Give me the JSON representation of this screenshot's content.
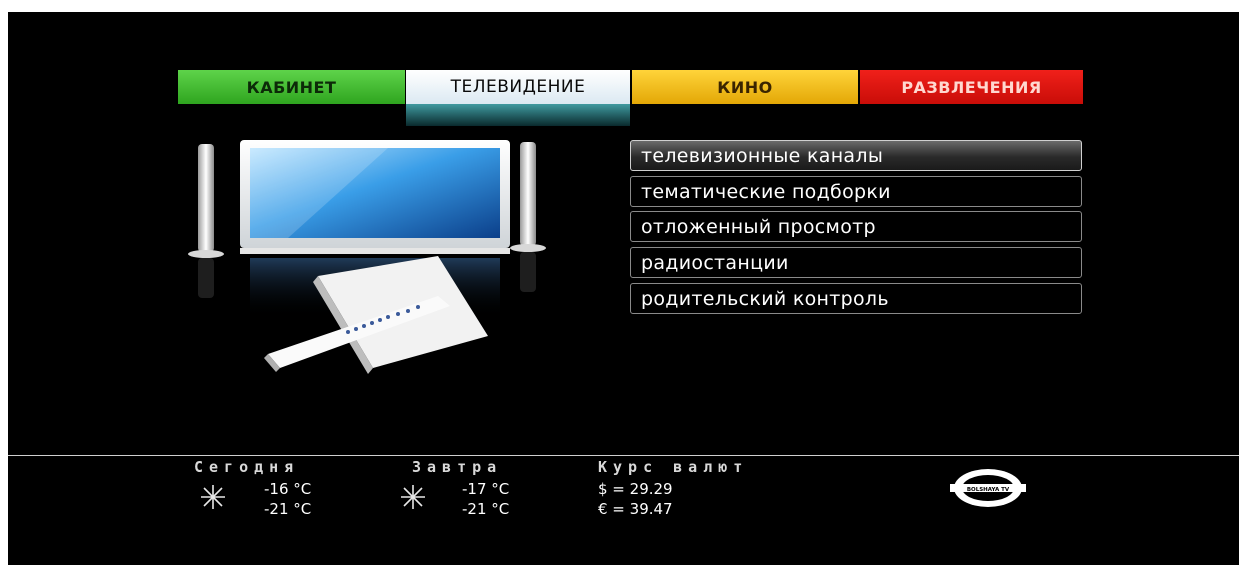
{
  "tabs": [
    {
      "label": "КАБИНЕТ",
      "color": "#2fa51f"
    },
    {
      "label": "ТЕЛЕВИДЕНИЕ",
      "color": "#ffffff",
      "active": true
    },
    {
      "label": "КИНО",
      "color": "#e3a706"
    },
    {
      "label": "РАЗВЛЕЧЕНИЯ",
      "color": "#c90d08"
    }
  ],
  "menu": {
    "items": [
      {
        "label": "телевизионные каналы",
        "selected": true
      },
      {
        "label": "тематические подборки"
      },
      {
        "label": "отложенный просмотр"
      },
      {
        "label": "радиостанции"
      },
      {
        "label": "родительский контроль"
      }
    ]
  },
  "footer": {
    "today": {
      "label": "Сегодня",
      "high": "-16 °C",
      "low": "-21 °C",
      "icon": "snowflake-icon"
    },
    "tomorrow": {
      "label": "Завтра",
      "high": "-17 °C",
      "low": "-21 °C",
      "icon": "snowflake-icon"
    },
    "currency": {
      "label": "Курс валют",
      "usd": "$ = 29.29",
      "eur": "€ = 39.47"
    },
    "logo_text": "BOLSHAYA TV"
  }
}
